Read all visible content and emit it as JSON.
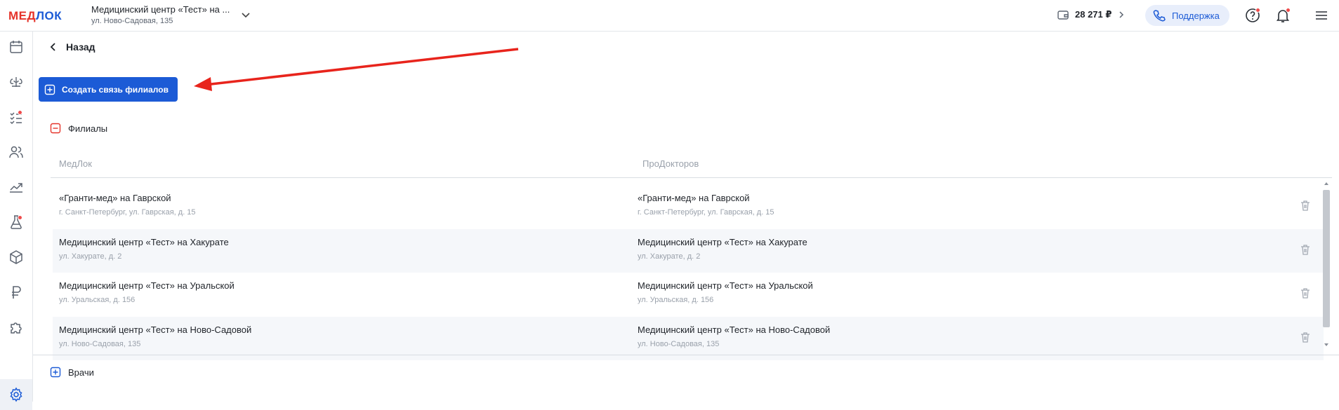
{
  "header": {
    "logo_part1": "МЕД",
    "logo_part2": "ЛОК",
    "clinic_name": "Медицинский центр «Тест» на ...",
    "clinic_address": "ул. Ново-Садовая, 135",
    "balance": "28 271 ₽",
    "support_label": "Поддержка"
  },
  "page": {
    "back_label": "Назад",
    "create_button_label": "Создать связь филиалов"
  },
  "branches": {
    "title": "Филиалы",
    "columns": [
      "МедЛок",
      "ПроДокторов"
    ],
    "rows": [
      {
        "medlok_name": "«Гранти-мед» на Гаврской",
        "medlok_address": "г. Санкт-Петербург, ул. Гаврская, д. 15",
        "prodoctorov_name": "«Гранти-мед» на Гаврской",
        "prodoctorov_address": "г. Санкт-Петербург, ул. Гаврская, д. 15"
      },
      {
        "medlok_name": "Медицинский центр «Тест» на Хакурате",
        "medlok_address": "ул. Хакурате, д. 2",
        "prodoctorov_name": "Медицинский центр «Тест» на Хакурате",
        "prodoctorov_address": "ул. Хакурате, д. 2"
      },
      {
        "medlok_name": "Медицинский центр «Тест» на Уральской",
        "medlok_address": "ул. Уральская, д. 156",
        "prodoctorov_name": "Медицинский центр «Тест» на Уральской",
        "prodoctorov_address": "ул. Уральская, д. 156"
      },
      {
        "medlok_name": "Медицинский центр «Тест» на Ново-Садовой",
        "medlok_address": "ул. Ново-Садовая, 135",
        "prodoctorov_name": "Медицинский центр «Тест» на Ново-Садовой",
        "prodoctorov_address": "ул. Ново-Садовая, 135"
      }
    ]
  },
  "doctors": {
    "title": "Врачи"
  },
  "colors": {
    "accent": "#1c5bd6",
    "logo_red": "#e5332a",
    "alert": "#ef4b4b"
  }
}
